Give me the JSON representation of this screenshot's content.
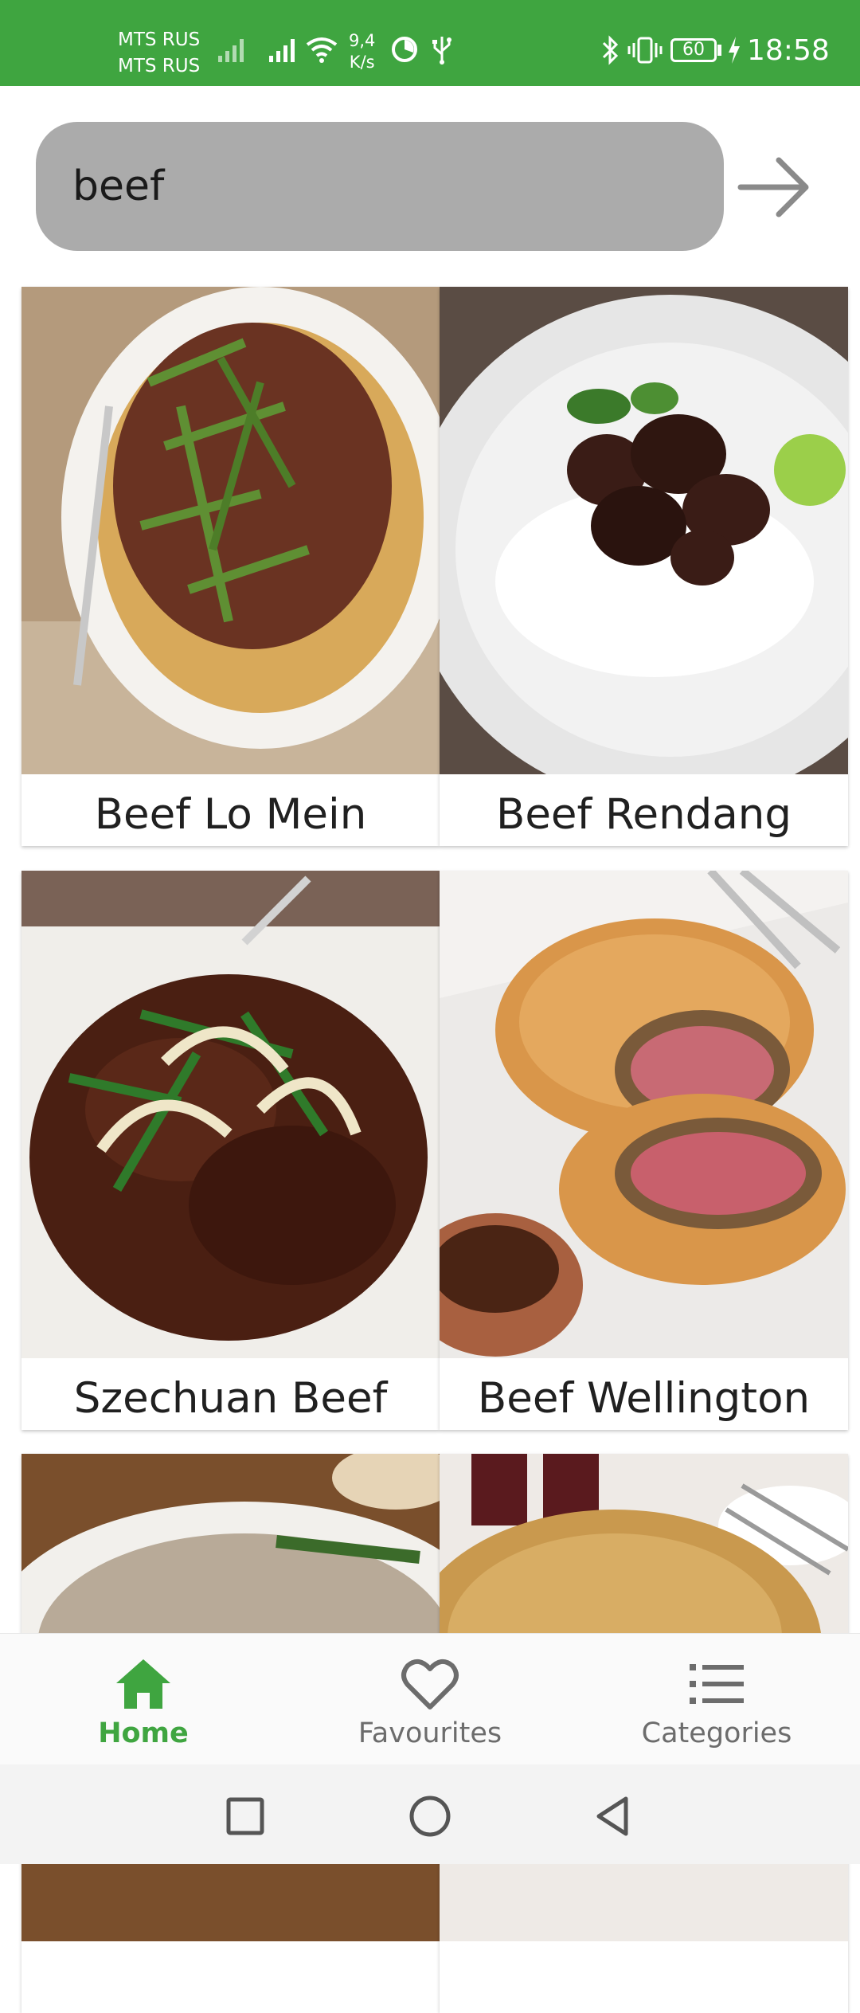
{
  "status_bar": {
    "carrier_1": "MTS RUS",
    "carrier_2": "MTS RUS",
    "speed_value": "9,4",
    "speed_unit": "K/s",
    "battery": "60",
    "time": "18:58",
    "icons": [
      "signal-icon",
      "signal-icon",
      "wifi-icon",
      "data-saver-icon",
      "usb-icon",
      "bluetooth-icon",
      "vibrate-icon",
      "battery-icon",
      "charging-icon"
    ]
  },
  "search": {
    "value": "beef",
    "icon": "arrow-right-icon"
  },
  "recipes": [
    {
      "name": "Beef Lo Mein"
    },
    {
      "name": "Beef Rendang"
    },
    {
      "name": "Szechuan Beef"
    },
    {
      "name": "Beef Wellington"
    },
    {
      "name": ""
    },
    {
      "name": ""
    }
  ],
  "bottom_nav": {
    "items": [
      {
        "label": "Home",
        "icon": "home-icon",
        "active": true
      },
      {
        "label": "Favourites",
        "icon": "heart-icon",
        "active": false
      },
      {
        "label": "Categories",
        "icon": "list-icon",
        "active": false
      }
    ]
  },
  "colors": {
    "accent": "#3fa540",
    "search_background": "#ababab",
    "inactive_nav": "#6c6c6c"
  },
  "system_nav": [
    "recent-apps-icon",
    "home-circle-icon",
    "back-icon"
  ]
}
